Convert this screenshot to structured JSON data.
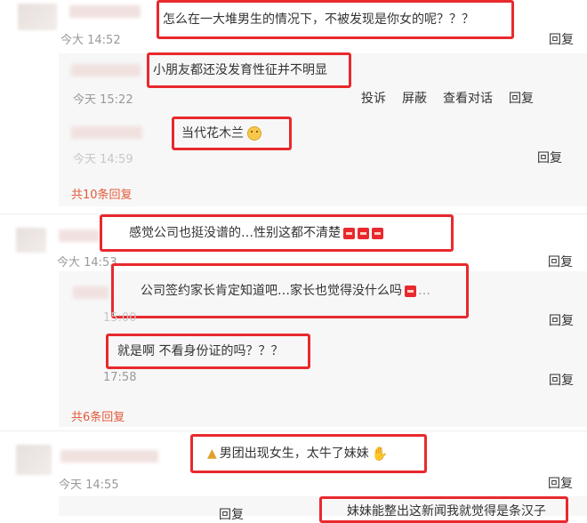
{
  "comments": [
    {
      "text": "怎么在一大堆男生的情况下，不被发现是你女的呢？？？",
      "time": "今大 14:52",
      "reply_label": "回复",
      "replies": [
        {
          "text": "小朋友都还没发育性征并不明显",
          "time": "今天 15:22",
          "actions": [
            "投诉",
            "屏蔽",
            "查看对话"
          ],
          "reply_label": "回复"
        },
        {
          "text": "当代花木兰",
          "emoji": "smirk-face-emoji",
          "time": "今天 14:59",
          "reply_label": "回复"
        }
      ],
      "more_replies": "共10条回复"
    },
    {
      "text": "感觉公司也挺没谱的…性别这都不清楚",
      "emoji_count": 3,
      "time": "今大 14:53",
      "reply_label": "回复",
      "replies": [
        {
          "text": "公司签约家长肯定知道吧…家长也觉得没什么吗",
          "time": "15:00",
          "reply_label": "回复"
        },
        {
          "text": "就是啊 不看身份证的吗？？？",
          "time": "17:58",
          "reply_label": "回复"
        }
      ],
      "more_replies": "共6条回复"
    },
    {
      "text": "男团出现女生，太牛了妹妹",
      "time": "今天 14:55",
      "reply_label": "回复"
    }
  ],
  "footer": {
    "reply_label": "回复",
    "text": "妹妹能整出这新闻我就觉得是条汉子"
  },
  "colors": {
    "highlight_box": "#e8292d",
    "more_replies": "#e35a3b",
    "reply_panel": "#f7f7f7",
    "muted": "#999999"
  }
}
